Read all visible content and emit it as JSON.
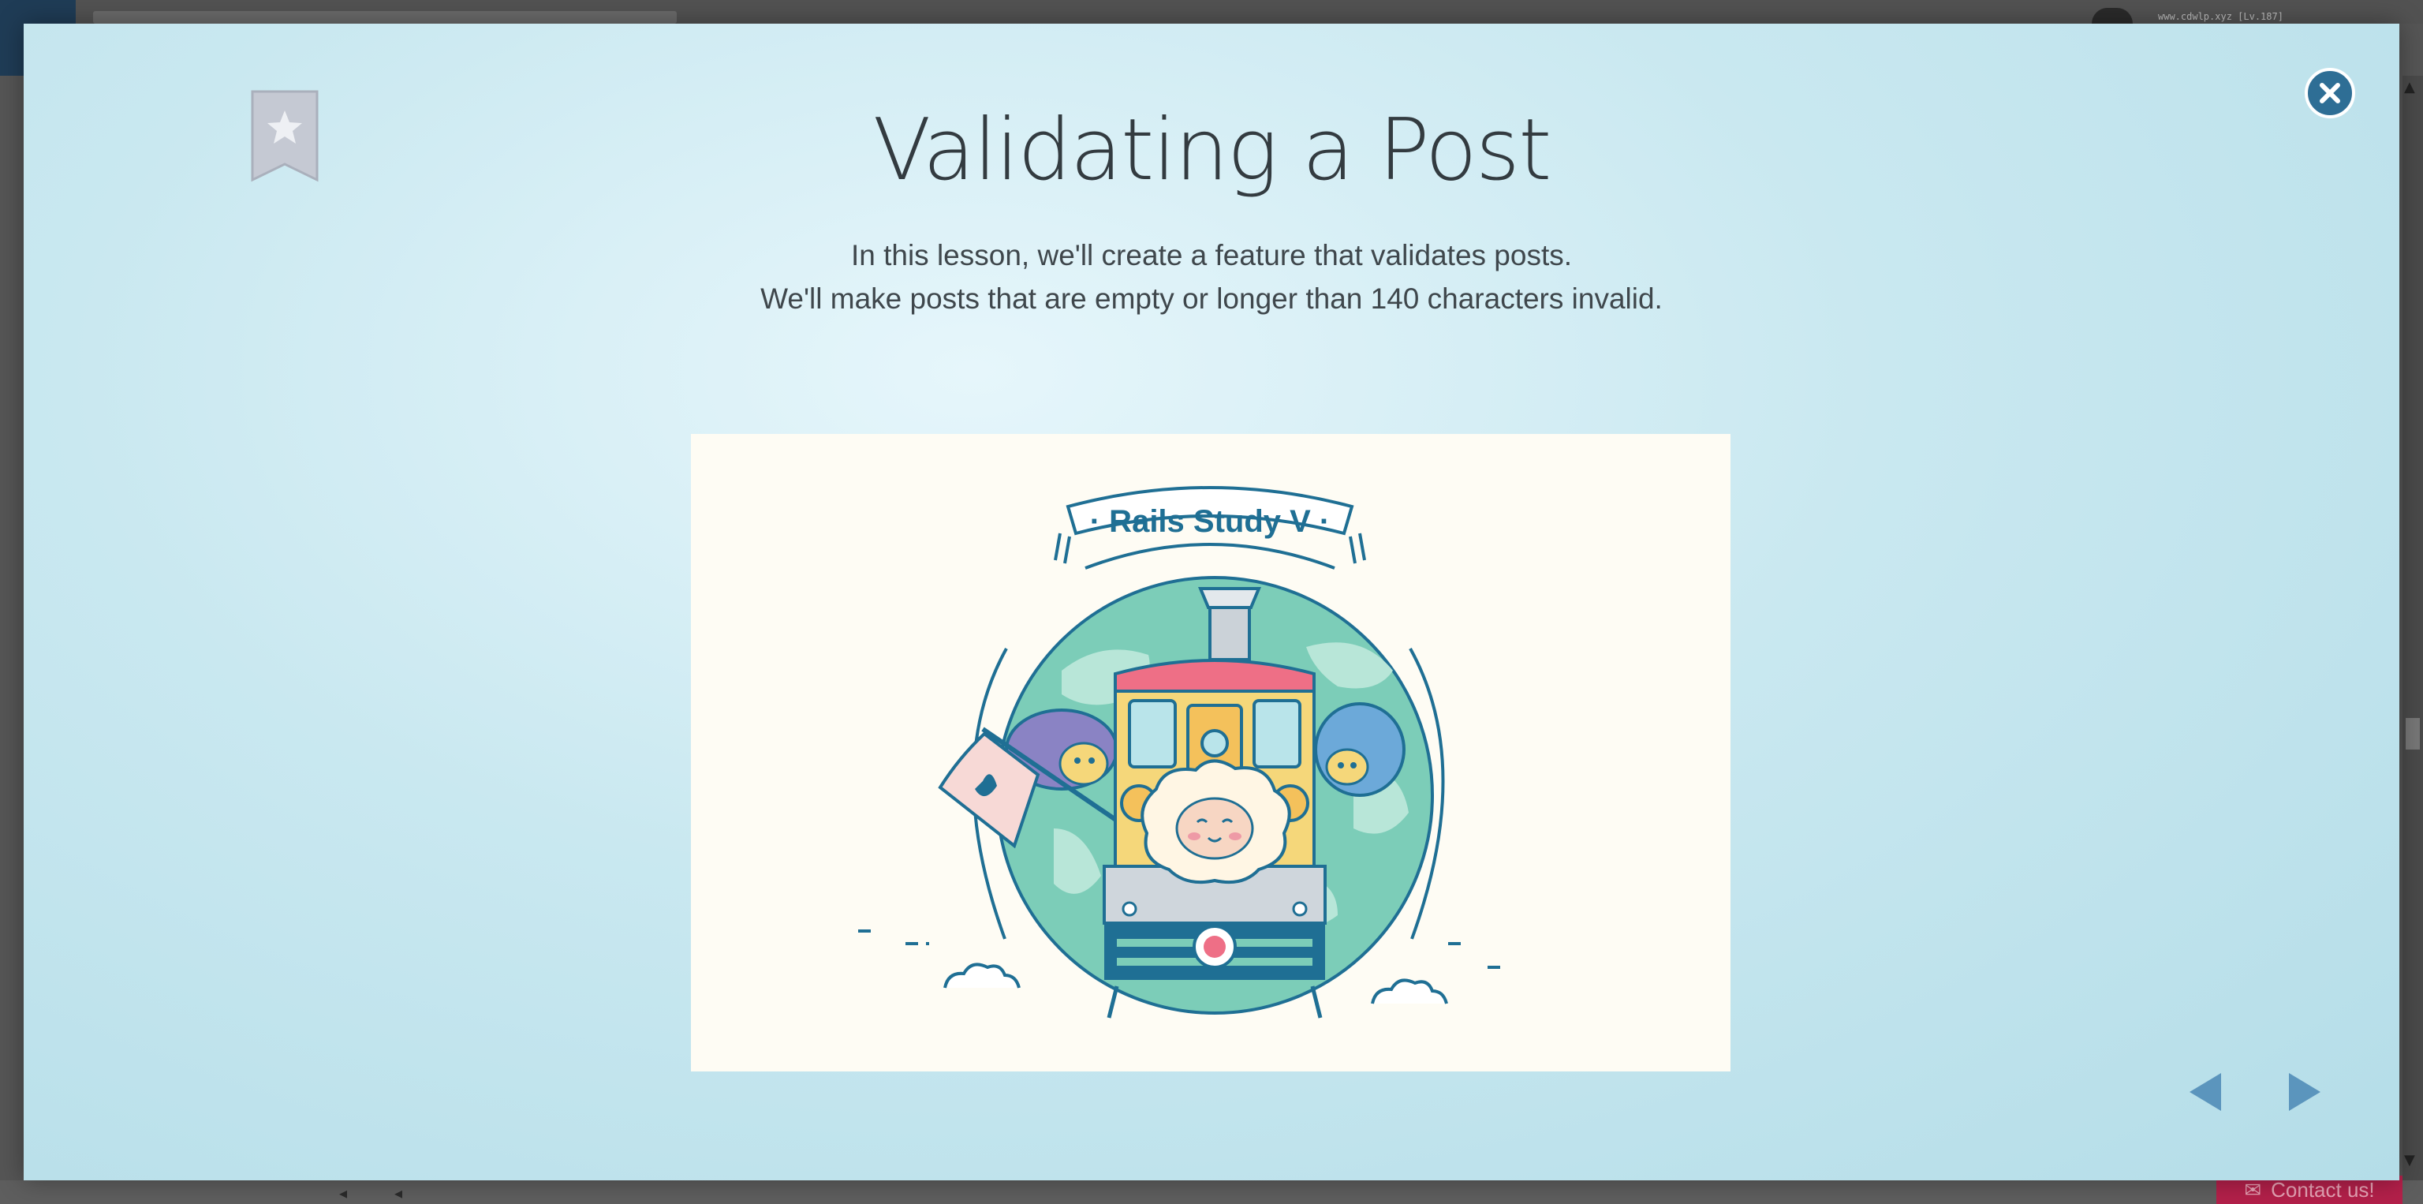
{
  "background_app": {
    "url_text": "www.cdwlp.xyz [Lv.187]",
    "contact_label": "Contact us!"
  },
  "lesson": {
    "title": "Validating a Post",
    "description_lines": [
      "In this lesson, we'll create a feature that validates posts.",
      "We'll make posts that are empty or longer than 140 characters invalid."
    ]
  },
  "illustration": {
    "banner_text": "· Rails Study V ·"
  },
  "icons": {
    "bookmark": "bookmark-star-icon",
    "close": "close-x-icon",
    "prev": "triangle-left-icon",
    "next": "triangle-right-icon"
  },
  "colors": {
    "modal_bg": "#c9e8f0",
    "close_button": "#2e6e95",
    "nav_arrow": "#5b95bd",
    "bookmark": "#c5c9d3",
    "title_text": "#333b40",
    "globe": "#7ccdb8",
    "train_body": "#f5d77a",
    "train_roof": "#ee6f86",
    "line_art": "#1f6f94"
  }
}
